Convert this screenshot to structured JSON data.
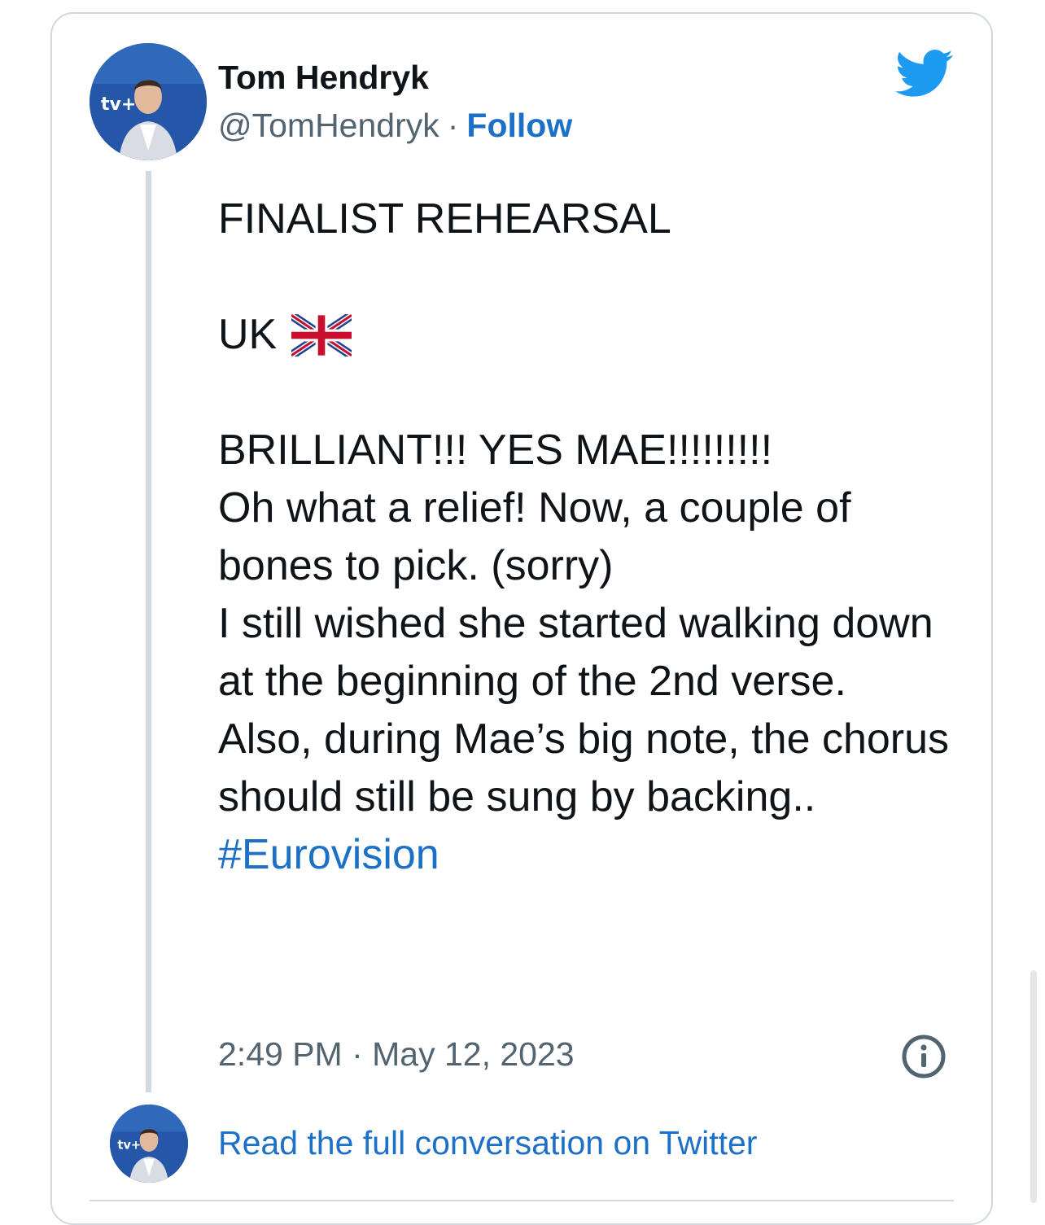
{
  "author": {
    "name": "Tom Hendryk",
    "handle": "@TomHendryk",
    "separator": "·",
    "follow_label": "Follow",
    "avatar_icon": "profile-photo"
  },
  "brand": {
    "icon": "twitter-bird-icon",
    "color": "#1d9bf0"
  },
  "tweet": {
    "lines": [
      "FINALIST REHEARSAL",
      "",
      "UK",
      "",
      "BRILLIANT!!! YES MAE!!!!!!!!!",
      "Oh what a relief! Now, a couple of bones to pick. (sorry)",
      "I still wished she started walking down at the beginning of the 2nd verse.",
      "Also, during Mae’s big note, the chorus should still be sung by backing..",
      "#Eurovision"
    ],
    "flag_emoji": "uk-flag-icon",
    "hashtag": "#Eurovision"
  },
  "meta": {
    "timestamp": "2:49 PM · May 12, 2023",
    "info_icon": "info-icon"
  },
  "footer": {
    "read_more": "Read the full conversation on Twitter"
  },
  "colors": {
    "link": "#1d70c7",
    "text": "#0f1419",
    "muted": "#536471",
    "border": "#cfd9de"
  }
}
